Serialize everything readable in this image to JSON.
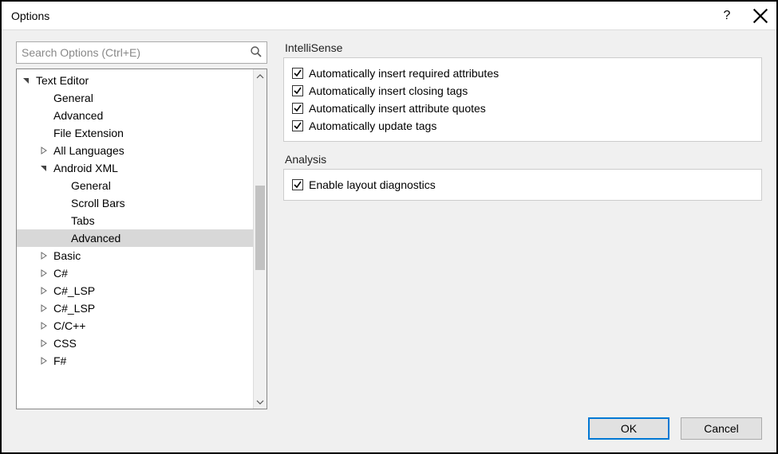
{
  "window": {
    "title": "Options"
  },
  "search": {
    "placeholder": "Search Options (Ctrl+E)"
  },
  "tree": [
    {
      "label": "Text Editor",
      "depth": 0,
      "expander": "expanded"
    },
    {
      "label": "General",
      "depth": 1,
      "expander": "none"
    },
    {
      "label": "Advanced",
      "depth": 1,
      "expander": "none"
    },
    {
      "label": "File Extension",
      "depth": 1,
      "expander": "none"
    },
    {
      "label": "All Languages",
      "depth": 1,
      "expander": "collapsed"
    },
    {
      "label": "Android XML",
      "depth": 1,
      "expander": "expanded"
    },
    {
      "label": "General",
      "depth": 2,
      "expander": "none"
    },
    {
      "label": "Scroll Bars",
      "depth": 2,
      "expander": "none"
    },
    {
      "label": "Tabs",
      "depth": 2,
      "expander": "none"
    },
    {
      "label": "Advanced",
      "depth": 2,
      "expander": "none",
      "selected": true
    },
    {
      "label": "Basic",
      "depth": 1,
      "expander": "collapsed"
    },
    {
      "label": "C#",
      "depth": 1,
      "expander": "collapsed"
    },
    {
      "label": "C#_LSP",
      "depth": 1,
      "expander": "collapsed"
    },
    {
      "label": "C#_LSP",
      "depth": 1,
      "expander": "collapsed"
    },
    {
      "label": "C/C++",
      "depth": 1,
      "expander": "collapsed"
    },
    {
      "label": "CSS",
      "depth": 1,
      "expander": "collapsed"
    },
    {
      "label": "F#",
      "depth": 1,
      "expander": "collapsed"
    }
  ],
  "groups": [
    {
      "title": "IntelliSense",
      "checks": [
        {
          "label": "Automatically insert required attributes",
          "checked": true
        },
        {
          "label": "Automatically insert closing tags",
          "checked": true
        },
        {
          "label": "Automatically insert attribute quotes",
          "checked": true
        },
        {
          "label": "Automatically update tags",
          "checked": true
        }
      ]
    },
    {
      "title": "Analysis",
      "checks": [
        {
          "label": "Enable layout diagnostics",
          "checked": true
        }
      ]
    }
  ],
  "buttons": {
    "ok": "OK",
    "cancel": "Cancel"
  },
  "scrollbar": {
    "thumb_top_pct": 33,
    "thumb_height_pct": 27
  }
}
